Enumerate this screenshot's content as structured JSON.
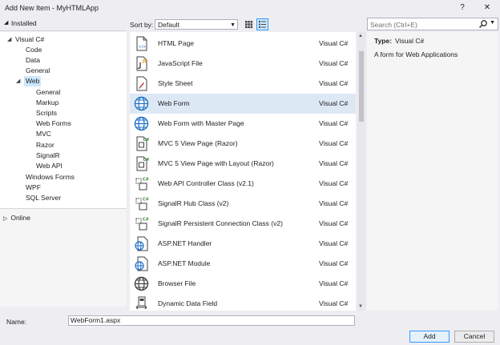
{
  "window": {
    "title": "Add New Item - MyHTMLApp",
    "help": "?",
    "close": "✕"
  },
  "tree": {
    "header": "Installed",
    "nodes": [
      {
        "label": "Visual C#"
      },
      {
        "label": "Code"
      },
      {
        "label": "Data"
      },
      {
        "label": "General"
      },
      {
        "label": "Web"
      },
      {
        "label": "General"
      },
      {
        "label": "Markup"
      },
      {
        "label": "Scripts"
      },
      {
        "label": "Web Forms"
      },
      {
        "label": "MVC"
      },
      {
        "label": "Razor"
      },
      {
        "label": "SignalR"
      },
      {
        "label": "Web API"
      },
      {
        "label": "Windows Forms"
      },
      {
        "label": "WPF"
      },
      {
        "label": "SQL Server"
      }
    ],
    "online": "Online"
  },
  "toolbar": {
    "sort_label": "Sort by:",
    "sort_value": "Default"
  },
  "search": {
    "placeholder": "Search (Ctrl+E)"
  },
  "templates": [
    {
      "name": "HTML Page",
      "type": "Visual C#",
      "icon": "html-page-icon"
    },
    {
      "name": "JavaScript File",
      "type": "Visual C#",
      "icon": "javascript-file-icon"
    },
    {
      "name": "Style Sheet",
      "type": "Visual C#",
      "icon": "style-sheet-icon"
    },
    {
      "name": "Web Form",
      "type": "Visual C#",
      "icon": "globe-icon"
    },
    {
      "name": "Web Form with Master Page",
      "type": "Visual C#",
      "icon": "globe-icon"
    },
    {
      "name": "MVC 5 View Page (Razor)",
      "type": "Visual C#",
      "icon": "mvc-view-icon"
    },
    {
      "name": "MVC 5 View Page with Layout (Razor)",
      "type": "Visual C#",
      "icon": "mvc-view-icon"
    },
    {
      "name": "Web API Controller Class (v2.1)",
      "type": "Visual C#",
      "icon": "csharp-class-icon"
    },
    {
      "name": "SignalR Hub Class (v2)",
      "type": "Visual C#",
      "icon": "csharp-class-icon"
    },
    {
      "name": "SignalR Persistent Connection Class (v2)",
      "type": "Visual C#",
      "icon": "csharp-class-icon"
    },
    {
      "name": "ASP.NET Handler",
      "type": "Visual C#",
      "icon": "globe-file-icon"
    },
    {
      "name": "ASP.NET Module",
      "type": "Visual C#",
      "icon": "globe-file-icon"
    },
    {
      "name": "Browser File",
      "type": "Visual C#",
      "icon": "browser-file-icon"
    },
    {
      "name": "Dynamic Data Field",
      "type": "Visual C#",
      "icon": "dynamic-data-icon"
    }
  ],
  "details": {
    "type_label": "Type:",
    "type_value": "Visual C#",
    "description": "A form for Web Applications"
  },
  "footer": {
    "name_label": "Name:",
    "name_value": "WebForm1.aspx",
    "add": "Add",
    "cancel": "Cancel"
  }
}
